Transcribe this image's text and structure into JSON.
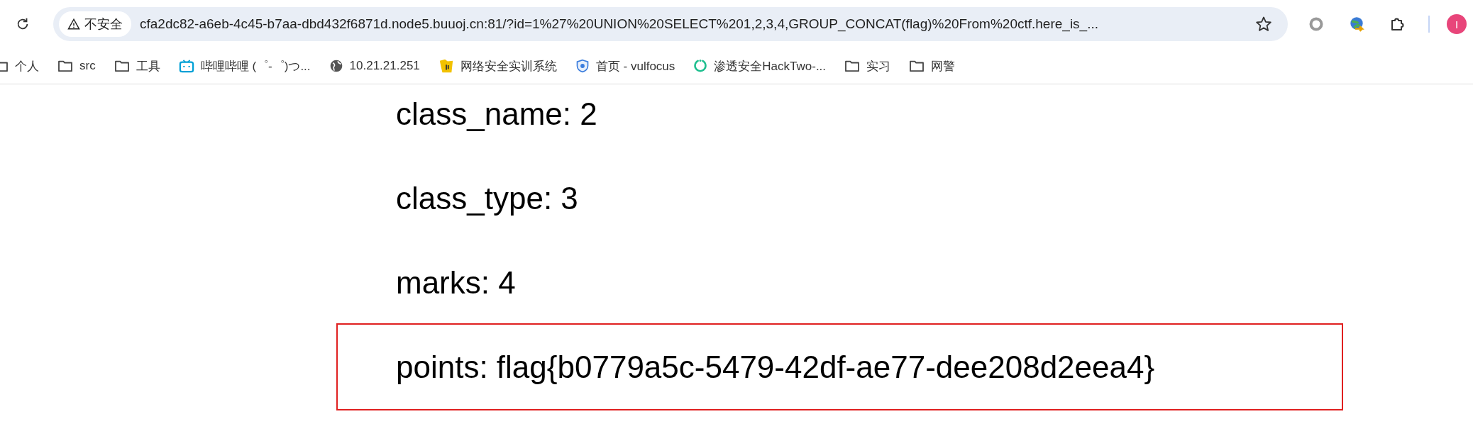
{
  "toolbar": {
    "security_label": "不安全",
    "url": "cfa2dc82-a6eb-4c45-b7aa-dbd432f6871d.node5.buuoj.cn:81/?id=1%27%20UNION%20SELECT%201,2,3,4,GROUP_CONCAT(flag)%20From%20ctf.here_is_...",
    "profile_initial": "I"
  },
  "bookmarks": [
    {
      "kind": "folder",
      "label": "个人"
    },
    {
      "kind": "folder",
      "label": "src"
    },
    {
      "kind": "folder",
      "label": "工具"
    },
    {
      "kind": "tv",
      "label": "哔哩哔哩 (゜-゜)つ..."
    },
    {
      "kind": "globe",
      "label": "10.21.21.251"
    },
    {
      "kind": "badge",
      "label": "网络安全实训系统"
    },
    {
      "kind": "shield",
      "label": "首页 - vulfocus"
    },
    {
      "kind": "ring",
      "label": "渗透安全HackTwo-..."
    },
    {
      "kind": "folder",
      "label": "实习"
    },
    {
      "kind": "folder",
      "label": "网警"
    }
  ],
  "fields": [
    {
      "text": "class_name: 2",
      "highlighted": false
    },
    {
      "text": "class_type: 3",
      "highlighted": false
    },
    {
      "text": "marks: 4",
      "highlighted": false
    },
    {
      "text": "points: flag{b0779a5c-5479-42df-ae77-dee208d2eea4}",
      "highlighted": true
    }
  ]
}
